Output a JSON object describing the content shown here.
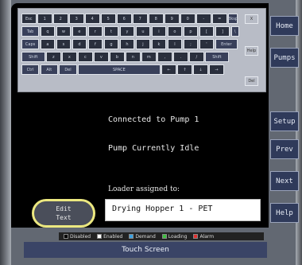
{
  "keyboard": {
    "rows": [
      [
        "Esc",
        "1",
        "2",
        "3",
        "4",
        "5",
        "6",
        "7",
        "8",
        "9",
        "0",
        "-",
        "=",
        "Bksp"
      ],
      [
        "Tab",
        "q",
        "w",
        "e",
        "r",
        "t",
        "y",
        "u",
        "i",
        "o",
        "p",
        "[",
        "]",
        "\\"
      ],
      [
        "Caps",
        "a",
        "s",
        "d",
        "f",
        "g",
        "h",
        "j",
        "k",
        "l",
        ";",
        "'",
        "Enter"
      ],
      [
        "Shift",
        "z",
        "x",
        "c",
        "v",
        "b",
        "n",
        "m",
        ",",
        ".",
        "/",
        "Shift"
      ],
      [
        "Ctrl",
        "Alt",
        "Del",
        "SPACE",
        "←",
        "↑",
        "↓",
        "→"
      ]
    ],
    "side_keys": [
      "X",
      "Help",
      "Del"
    ]
  },
  "nav": {
    "home": "Home",
    "pumps": "Pumps",
    "setup": "Setup",
    "prev": "Prev",
    "next": "Next",
    "help": "Help"
  },
  "status": {
    "connection": "Connected to Pump 1",
    "state": "Pump Currently Idle"
  },
  "loader": {
    "label": "Loader assigned to:",
    "value": "Drying Hopper 1 - PET"
  },
  "edit_button": {
    "label": "Edit\nText"
  },
  "legend": [
    {
      "label": "Disabled",
      "color": "#000000"
    },
    {
      "label": "Enabled",
      "color": "#ffffff"
    },
    {
      "label": "Demand",
      "color": "#3aa0e0"
    },
    {
      "label": "Loading",
      "color": "#3ec040"
    },
    {
      "label": "Alarm",
      "color": "#e03030"
    }
  ],
  "footer": {
    "title": "Touch Screen"
  }
}
